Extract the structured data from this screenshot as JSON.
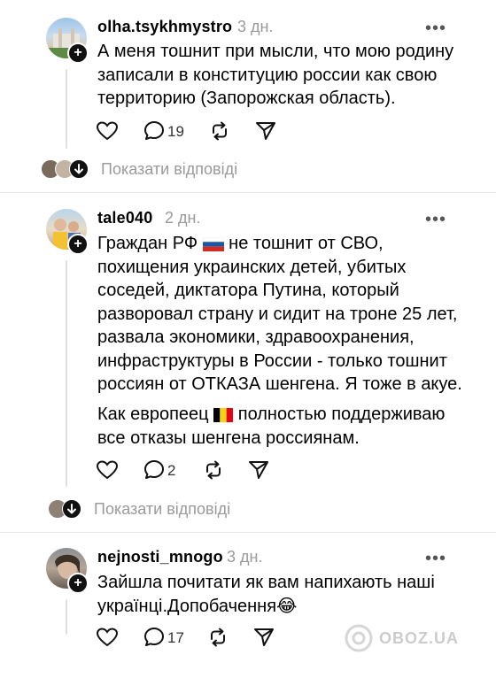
{
  "comments": [
    {
      "username": "olha.tsykhmystro",
      "time": "3 дн.",
      "more": "•••",
      "lines": [
        "А меня тошнит при мысли, что мою родину",
        "записали в конституцию россии как свою",
        "территорию (Запорожская область)."
      ],
      "reply_count": "19",
      "show_replies": "Показати відповіді"
    },
    {
      "username": "tale040",
      "time": "2 дн.",
      "more": "•••",
      "line1_a": "Граждан РФ",
      "line1_b": "не тошнит от СВО,",
      "lines": [
        "похищения украинских детей, убитых",
        "соседей, диктатора Путина, который",
        "разворовал страну и сидит на троне 25 лет,",
        "развала экономики, здравоохранения,",
        "инфраструктуры в России - только тошнит",
        "россиян от ОТКАЗА шенгена. Я тоже в акуе."
      ],
      "p2_a": "Как европеец",
      "p2_b": "полностью поддерживаю",
      "p2_line2": "все отказы шенгена россиянам.",
      "reply_count": "2",
      "show_replies": "Показати відповіді"
    },
    {
      "username": "nejnosti_mnogo",
      "time": "3 дн.",
      "more": "•••",
      "lines": [
        "Зайшла почитати як вам напихають наші",
        "українці.Допобачення"
      ],
      "emoji": "😂",
      "reply_count": "17"
    }
  ],
  "watermark": "OBOZ.UA",
  "colors": {
    "text": "#000000",
    "secondary": "#9a9a9a",
    "divider": "#e6e6e6"
  }
}
